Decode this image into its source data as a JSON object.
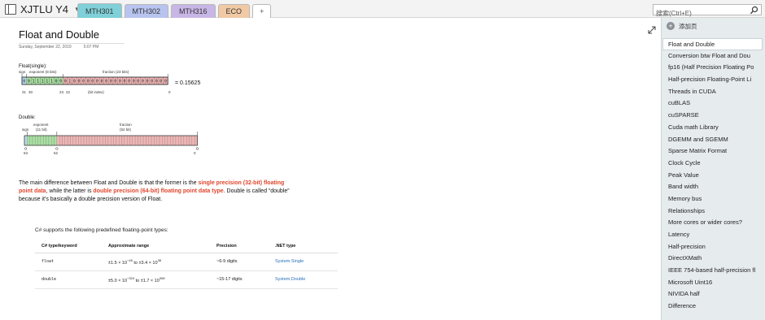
{
  "notebook": {
    "title": "XJTLU Y4",
    "icon": "notebook-icon"
  },
  "tabs": [
    {
      "label": "MTH301",
      "color": "#7fd0d8",
      "active": true
    },
    {
      "label": "MTH302",
      "color": "#b8c4ef"
    },
    {
      "label": "MTH316",
      "color": "#c8b6e6"
    },
    {
      "label": "ECO",
      "color": "#f1c9a5"
    }
  ],
  "tab_add_label": "+",
  "search": {
    "placeholder": "搜索(Ctrl+E)",
    "icon": "search-icon"
  },
  "page": {
    "title": "Float and Double",
    "date": "Sunday, September 22, 2019",
    "time": "5:07 PM"
  },
  "float_figure": {
    "caption": "Float(single):",
    "sign_label": "sign",
    "exponent_label": "exponent (8 bits)",
    "fraction_label": "fraction (23 bits)",
    "sign_bit": "0",
    "exponent_bits": "01111100",
    "fraction_bits": "01000000000000000000000",
    "equals": "= 0.15625",
    "tick_31": "31",
    "tick_30": "30",
    "tick_23": "23",
    "tick_22": "22",
    "tick_0": "0",
    "bit_index_label": "(bit index)"
  },
  "double_figure": {
    "caption": "Double:",
    "sign_label": "sign",
    "exponent_label": "exponent",
    "exponent_bits_label": "(11 bit)",
    "fraction_label": "fraction",
    "fraction_bits_label": "(52 bit)",
    "tick_63": "63",
    "tick_52": "52",
    "tick_0": "0"
  },
  "paragraph": {
    "p1": "The main difference between Float and Double is that the former is the ",
    "h1": "single precision (32-bit) floating point data",
    "p2": ", while the latter is ",
    "h2": "double precision (64-bit) floating point data type",
    "p3": ". Double is called “double” because it’s basically a double precision version of Float."
  },
  "table": {
    "caption": "C# supports the following predefined floating-point types:",
    "headers": [
      "C# type/keyword",
      "Approximate range",
      "Precision",
      ".NET type"
    ],
    "rows": [
      {
        "keyword": "float",
        "range_a": "±1.5 × 10",
        "range_a_exp": "−45",
        "range_mid": " to ±3.4 × 10",
        "range_b_exp": "38",
        "precision": "~6-9 digits",
        "net": "System.Single"
      },
      {
        "keyword": "double",
        "range_a": "±5.0 × 10",
        "range_a_exp": "−324",
        "range_mid": " to ±1.7 × 10",
        "range_b_exp": "308",
        "precision": "~15-17 digits",
        "net": "System.Double"
      }
    ]
  },
  "sidebar": {
    "add_page": "添加页",
    "pages": [
      "Float and Double",
      "Conversion btw Float and Dou",
      "fp16 (Half Precision Floating Po",
      "Half-precision Floating-Point Li",
      "Threads in CUDA",
      "cuBLAS",
      "cuSPARSE",
      "Cuda math Library",
      "DGEMM and SGEMM",
      "Sparse Matrix Format",
      "Clock Cycle",
      "Peak Value",
      "Band width",
      "Memory bus",
      "Relationships",
      "More cores or wider cores?",
      "Latency",
      "Half-precision",
      "DirectXMath",
      "IEEE 754-based half-precision fl",
      "Microsoft Uint16",
      "NIVIDA half",
      "Difference"
    ]
  },
  "colors": {
    "sign": "#b8d8ee",
    "exponent": "#a7e0a0",
    "fraction": "#f0b3b3",
    "highlight": "#e0452b",
    "link": "#2a6fb8"
  }
}
